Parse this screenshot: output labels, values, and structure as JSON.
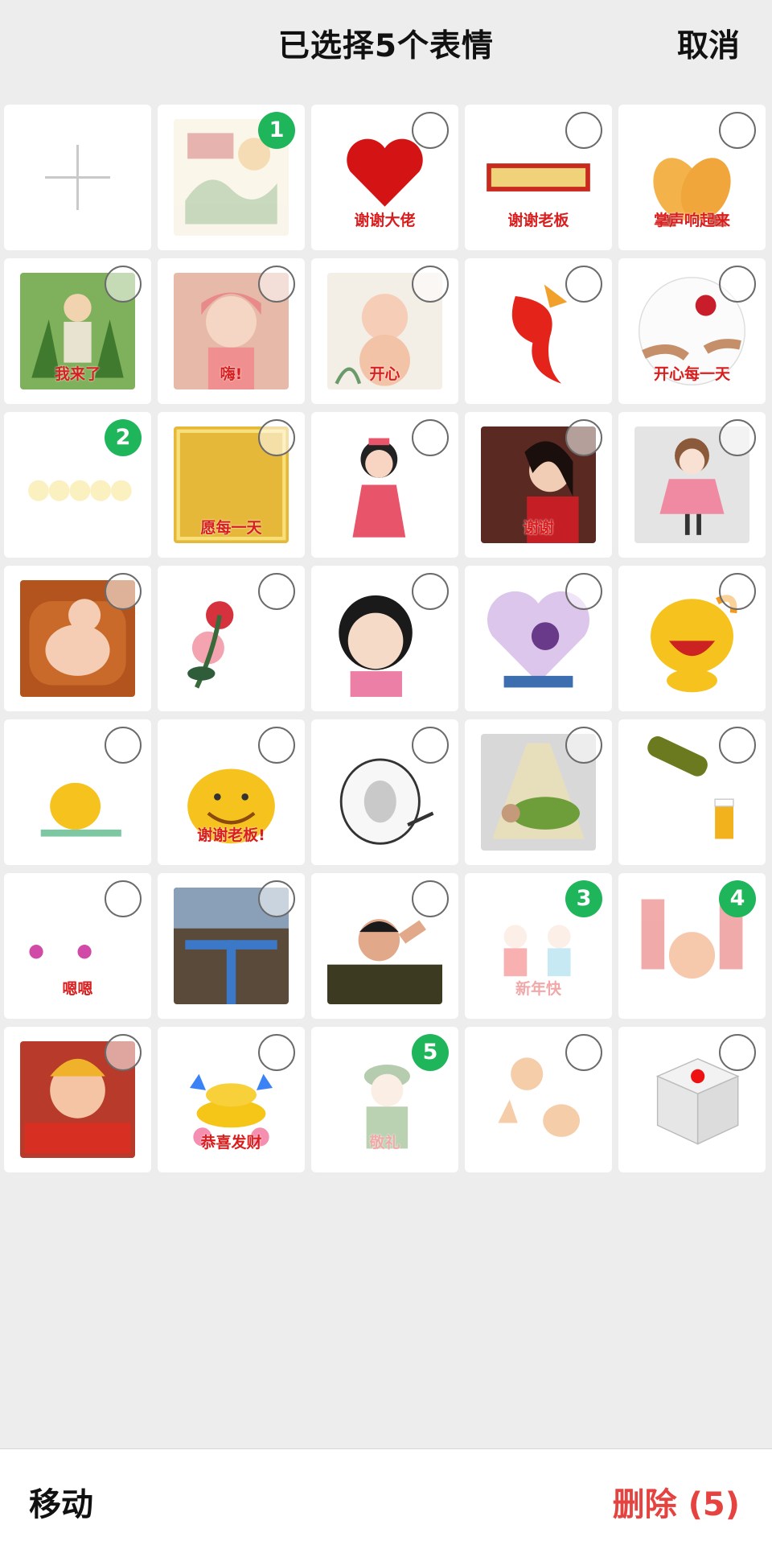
{
  "header": {
    "title": "已选择5个表情",
    "cancel_label": "取消"
  },
  "stickers": [
    {
      "kind": "add",
      "icon": "plus-icon"
    },
    {
      "kind": "sticker",
      "name": "dragon-boat-festival",
      "text": "",
      "selected": 1
    },
    {
      "kind": "sticker",
      "name": "red-heart",
      "text": "谢谢大佬",
      "selected": 0
    },
    {
      "kind": "sticker",
      "name": "thanks-boss-banner",
      "text": "谢谢老板",
      "selected": 0
    },
    {
      "kind": "sticker",
      "name": "applause-hands",
      "text": "掌声响起来",
      "selected": 0
    },
    {
      "kind": "sticker",
      "name": "old-man-zongzi",
      "text": "我来了",
      "selected": 0
    },
    {
      "kind": "sticker",
      "name": "baby-hi",
      "text": "嗨!",
      "selected": 0
    },
    {
      "kind": "sticker",
      "name": "baby-happy",
      "text": "开心",
      "selected": 0
    },
    {
      "kind": "sticker",
      "name": "red-fish",
      "text": "",
      "selected": 0
    },
    {
      "kind": "sticker",
      "name": "rose-happy-day",
      "text": "开心每一天",
      "selected": 0
    },
    {
      "kind": "sticker",
      "name": "yellow-chicks",
      "text": "",
      "selected": 2
    },
    {
      "kind": "sticker",
      "name": "gold-sunshine",
      "text": "愿每一天",
      "selected": 0
    },
    {
      "kind": "sticker",
      "name": "cartoon-girl-red",
      "text": "",
      "selected": 0
    },
    {
      "kind": "sticker",
      "name": "woman-thanks",
      "text": "谢谢",
      "selected": 0
    },
    {
      "kind": "sticker",
      "name": "cartoon-girl-pink",
      "text": "",
      "selected": 0
    },
    {
      "kind": "sticker",
      "name": "baby-chair",
      "text": "",
      "selected": 0
    },
    {
      "kind": "sticker",
      "name": "rose-weekend",
      "text": "",
      "selected": 0
    },
    {
      "kind": "sticker",
      "name": "girl-busy",
      "text": "",
      "selected": 0
    },
    {
      "kind": "sticker",
      "name": "heart-rose",
      "text": "",
      "selected": 0
    },
    {
      "kind": "sticker",
      "name": "qq-smile",
      "text": "",
      "selected": 0
    },
    {
      "kind": "sticker",
      "name": "qq-small",
      "text": "",
      "selected": 0
    },
    {
      "kind": "sticker",
      "name": "qq-thanks-boss",
      "text": "谢谢老板!",
      "selected": 0
    },
    {
      "kind": "sticker",
      "name": "meme-face",
      "text": "",
      "selected": 0
    },
    {
      "kind": "sticker",
      "name": "sleeping-man",
      "text": "",
      "selected": 0
    },
    {
      "kind": "sticker",
      "name": "beer-pour",
      "text": "",
      "selected": 0
    },
    {
      "kind": "sticker",
      "name": "en-en-text",
      "text": "嗯嗯",
      "selected": 0
    },
    {
      "kind": "sticker",
      "name": "dark-photo",
      "text": "",
      "selected": 0
    },
    {
      "kind": "sticker",
      "name": "man-salute",
      "text": "",
      "selected": 0
    },
    {
      "kind": "sticker",
      "name": "new-year-kids",
      "text": "新年快",
      "selected": 3
    },
    {
      "kind": "sticker",
      "name": "new-year-decor",
      "text": "",
      "selected": 4
    },
    {
      "kind": "sticker",
      "name": "baby-red-envelope",
      "text": "",
      "selected": 0
    },
    {
      "kind": "sticker",
      "name": "gold-ingots",
      "text": "恭喜发财",
      "selected": 0
    },
    {
      "kind": "sticker",
      "name": "soldier-salute",
      "text": "敬礼",
      "selected": 5
    },
    {
      "kind": "sticker",
      "name": "hand-gestures",
      "text": "",
      "selected": 0
    },
    {
      "kind": "sticker",
      "name": "white-dice",
      "text": "",
      "selected": 0
    }
  ],
  "bottom_bar": {
    "move_label": "移动",
    "delete_label": "删除 (5)"
  },
  "colors": {
    "check_green": "#1fb55b",
    "delete_red": "#e64340",
    "background": "#ededed"
  }
}
